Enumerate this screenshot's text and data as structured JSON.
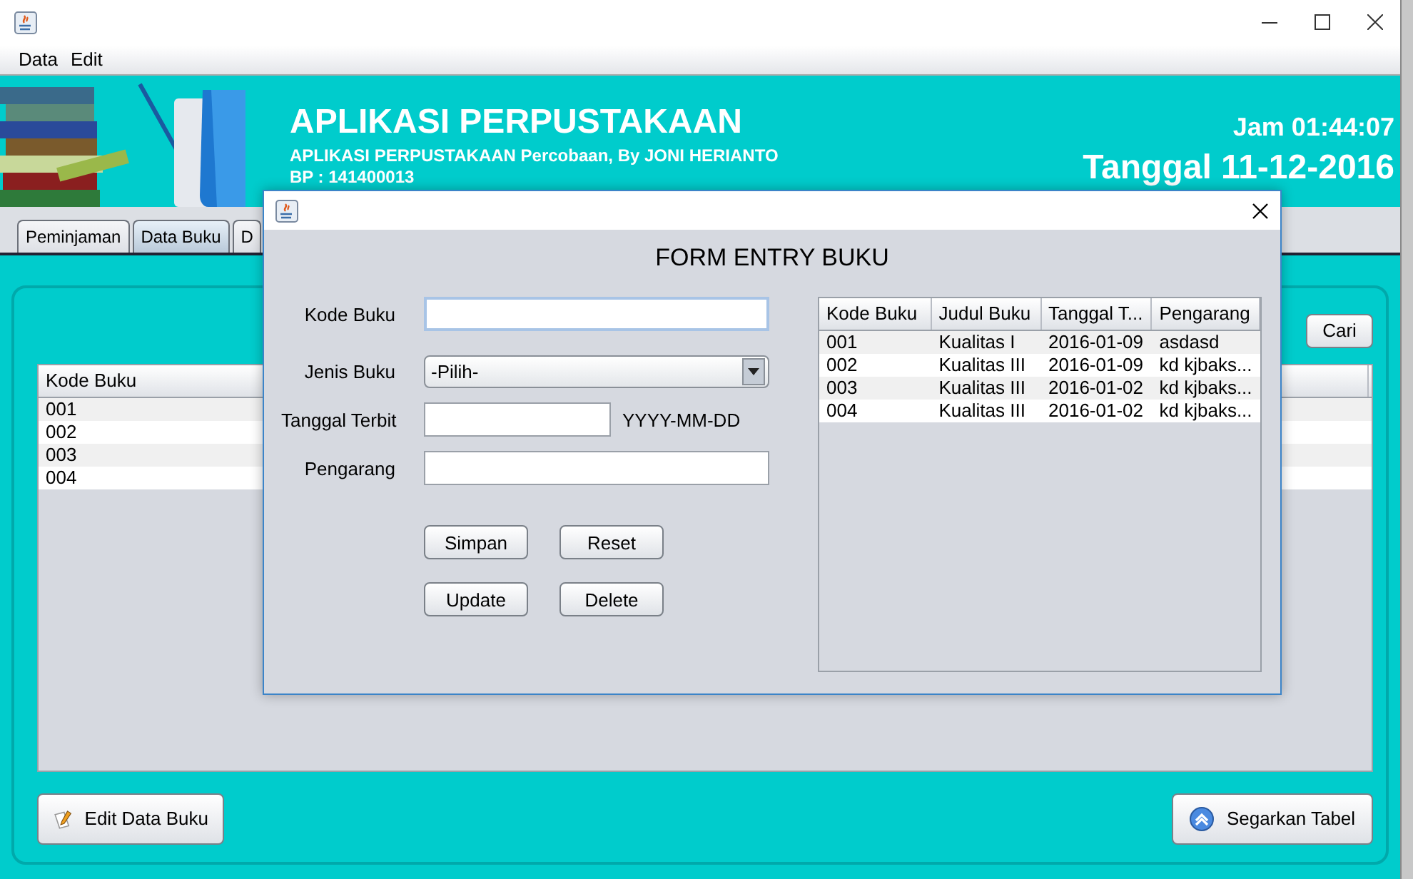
{
  "window": {
    "menu": [
      "Data",
      "Edit"
    ]
  },
  "banner": {
    "title": "APLIKASI PERPUSTAKAAN",
    "subtitle": "APLIKASI PERPUSTAKAAN Percobaan, By JONI HERIANTO",
    "id_line": "BP : 141400013",
    "clock": "Jam 01:44:07",
    "date": "Tanggal 11-12-2016"
  },
  "tabs": [
    {
      "label": "Peminjaman",
      "selected": false
    },
    {
      "label": "Data Buku",
      "selected": true
    },
    {
      "label": "D",
      "selected": false
    }
  ],
  "search_button": "Cari",
  "book_table": {
    "columns": [
      "Kode Buku"
    ],
    "rows": [
      [
        "001"
      ],
      [
        "002"
      ],
      [
        "003"
      ],
      [
        "004"
      ]
    ]
  },
  "footer_buttons": [
    {
      "label": "Edit Data Buku"
    },
    {
      "label": "Segarkan Tabel"
    }
  ],
  "dialog": {
    "title": "FORM ENTRY BUKU",
    "fields": [
      {
        "kind": "text",
        "label": "Kode Buku",
        "focused": true
      },
      {
        "kind": "select",
        "label": "Jenis Buku",
        "value": "-Pilih-"
      },
      {
        "kind": "date",
        "label": "Tanggal Terbit",
        "hint": "YYYY-MM-DD"
      },
      {
        "kind": "text",
        "label": "Pengarang",
        "focused": false
      }
    ],
    "buttons": [
      "Simpan",
      "Reset",
      "Update",
      "Delete"
    ],
    "table": {
      "columns": [
        "Kode Buku",
        "Judul Buku",
        "Tanggal T...",
        "Pengarang"
      ],
      "rows": [
        [
          "001",
          "Kualitas I",
          "2016-01-09",
          "asdasd"
        ],
        [
          "002",
          "Kualitas III",
          "2016-01-09",
          "kd kjbaks..."
        ],
        [
          "003",
          "Kualitas III",
          "2016-01-02",
          "kd kjbaks..."
        ],
        [
          "004",
          "Kualitas III",
          "2016-01-02",
          "kd kjbaks..."
        ]
      ]
    }
  }
}
